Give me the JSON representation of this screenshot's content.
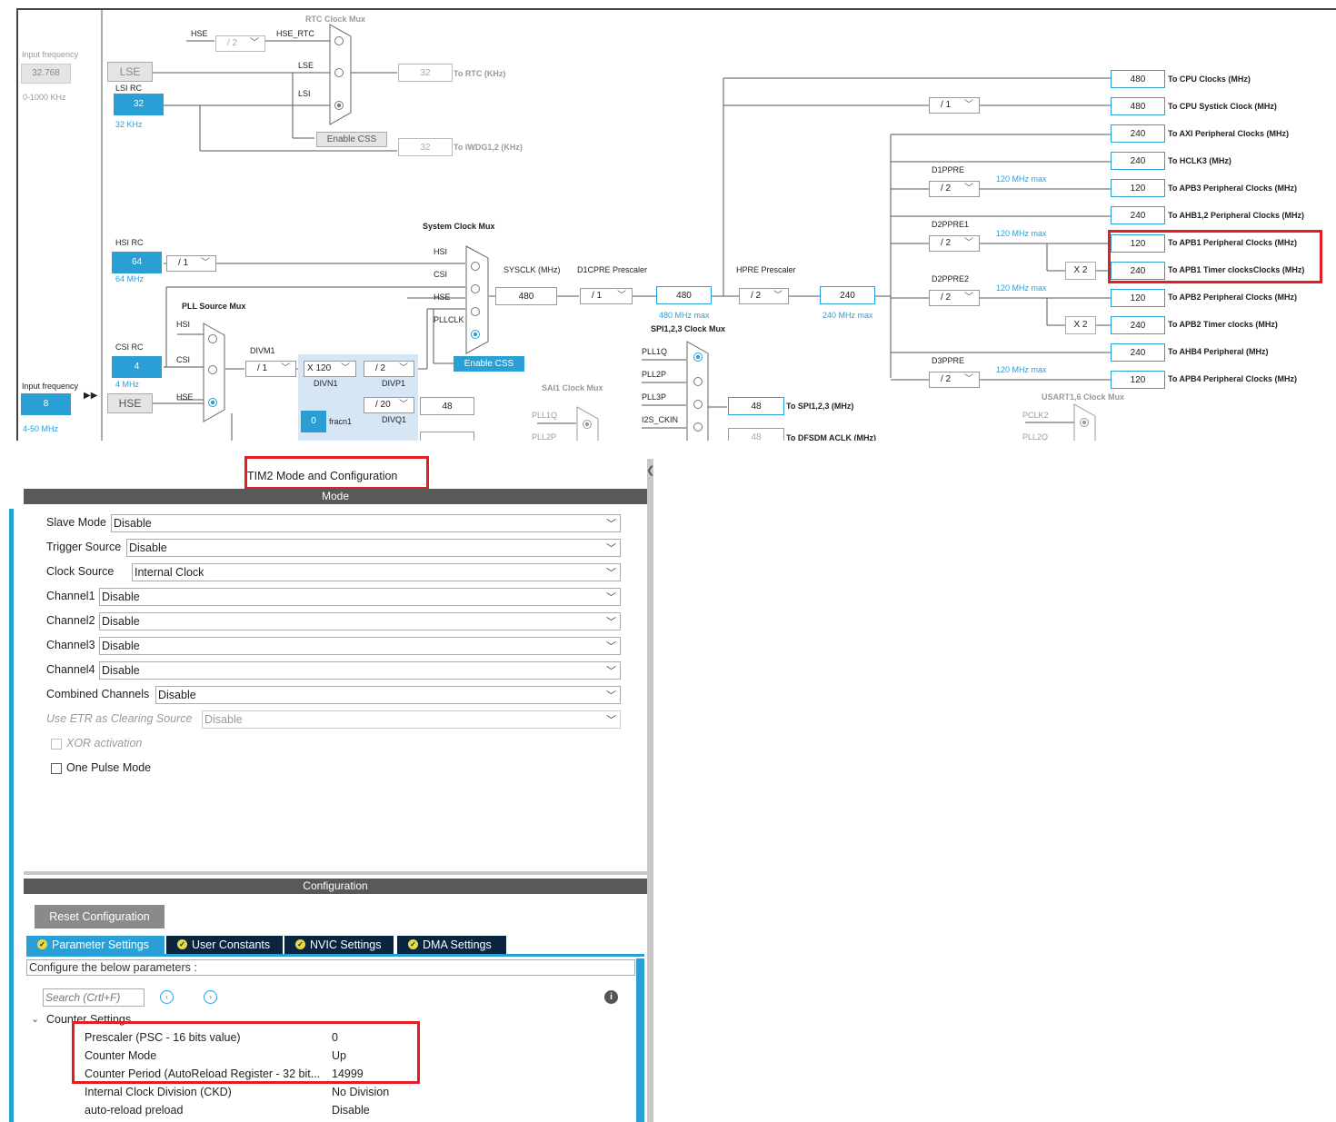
{
  "clock": {
    "rtc": {
      "title": "RTC Clock Mux",
      "hse": "HSE",
      "div": "/ 2",
      "hse_rtc": "HSE_RTC",
      "lse": "LSE",
      "lsi": "LSI",
      "enable_css": "Enable CSS",
      "rtc_val": "32",
      "rtc_lbl": "To RTC (KHz)",
      "iwdg_val": "32",
      "iwdg_lbl": "To IWDG1,2 (KHz)"
    },
    "inputs": {
      "lse_freq_lbl": "Input frequency",
      "lse_freq": "32.768",
      "lse_range": "0-1000 KHz",
      "lse": "LSE",
      "lsi_rc": "LSI RC",
      "lsi_val": "32",
      "lsi_unit": "32 KHz",
      "hsi_rc": "HSI RC",
      "hsi_val": "64",
      "hsi_div": "/ 1",
      "hsi_unit": "64 MHz",
      "csi_rc": "CSI RC",
      "csi_val": "4",
      "csi_unit": "4 MHz",
      "hse_freq_lbl": "Input frequency",
      "hse_freq": "8",
      "hse_range": "4-50 MHz",
      "hse": "HSE"
    },
    "pll": {
      "title": "PLL Source Mux",
      "hsi": "HSI",
      "csi": "CSI",
      "hse": "HSE",
      "divm1": "DIVM1",
      "divm_val": "/ 1",
      "divn_val": "X 120",
      "divn": "DIVN1",
      "divp_val": "/ 2",
      "divp": "DIVP1",
      "divq_val": "/ 20",
      "divq": "DIVQ1",
      "frac_val": "0",
      "frac": "fracn1",
      "q_out": "48"
    },
    "sys": {
      "title": "System Clock Mux",
      "hsi": "HSI",
      "csi": "CSI",
      "hse": "HSE",
      "pllclk": "PLLCLK",
      "enable_css": "Enable CSS",
      "sysclk_lbl": "SYSCLK (MHz)",
      "sysclk": "480",
      "d1cpre_lbl": "D1CPRE Prescaler",
      "d1cpre": "/ 1",
      "d1_out": "480",
      "d1_max": "480 MHz max",
      "hpre_lbl": "HPRE Prescaler",
      "hpre": "/ 2",
      "hpre_out": "240",
      "hpre_max": "240 MHz max",
      "cpu_div": "/ 1"
    },
    "spi": {
      "title": "SPI1,2,3 Clock Mux",
      "pll1q": "PLL1Q",
      "pll2p": "PLL2P",
      "pll3p": "PLL3P",
      "i2s": "I2S_CKIN",
      "val": "48",
      "lbl": "To SPI1,2,3 (MHz)",
      "dfsdm_val": "48",
      "dfsdm_lbl": "To DFSDM ACLK (MHz)"
    },
    "sai": {
      "title": "SAI1 Clock Mux",
      "pll1q": "PLL1Q",
      "pll2p": "PLL2P"
    },
    "usart": {
      "title": "USART1,6 Clock Mux",
      "pclk2": "PCLK2",
      "pll2q": "PLL2Q"
    },
    "pre": {
      "d1ppre": "D1PPRE",
      "d1ppre_val": "/ 2",
      "d2ppre1": "D2PPRE1",
      "d2ppre1_val": "/ 2",
      "d2ppre2": "D2PPRE2",
      "d2ppre2_val": "/ 2",
      "d3ppre": "D3PPRE",
      "d3ppre_val": "/ 2",
      "max": "120 MHz max",
      "x2": "X 2"
    },
    "outputs": [
      {
        "val": "480",
        "lbl": "To CPU Clocks (MHz)"
      },
      {
        "val": "480",
        "lbl": "To CPU Systick Clock (MHz)"
      },
      {
        "val": "240",
        "lbl": "To AXI Peripheral Clocks (MHz)"
      },
      {
        "val": "240",
        "lbl": "To HCLK3 (MHz)"
      },
      {
        "val": "120",
        "lbl": "To APB3 Peripheral Clocks (MHz)"
      },
      {
        "val": "240",
        "lbl": "To AHB1,2 Peripheral Clocks (MHz)"
      },
      {
        "val": "120",
        "lbl": "To APB1 Peripheral Clocks (MHz)"
      },
      {
        "val": "240",
        "lbl": "To APB1 Timer clocksClocks (MHz)"
      },
      {
        "val": "120",
        "lbl": "To APB2 Peripheral Clocks (MHz)"
      },
      {
        "val": "240",
        "lbl": "To APB2 Timer clocks (MHz)"
      },
      {
        "val": "240",
        "lbl": "To AHB4 Peripheral (MHz)"
      },
      {
        "val": "120",
        "lbl": "To APB4 Peripheral Clocks (MHz)"
      }
    ]
  },
  "tim": {
    "title": "TIM2 Mode and Configuration",
    "mode_header": "Mode",
    "mode": [
      {
        "label": "Slave Mode",
        "value": "Disable"
      },
      {
        "label": "Trigger Source",
        "value": "Disable"
      },
      {
        "label": "Clock Source",
        "value": "Internal Clock"
      },
      {
        "label": "Channel1",
        "value": "Disable"
      },
      {
        "label": "Channel2",
        "value": "Disable"
      },
      {
        "label": "Channel3",
        "value": "Disable"
      },
      {
        "label": "Channel4",
        "value": "Disable"
      },
      {
        "label": "Combined Channels",
        "value": "Disable"
      },
      {
        "label": "Use ETR as Clearing Source",
        "value": "Disable"
      }
    ],
    "xor": "XOR activation",
    "one_pulse": "One Pulse Mode",
    "config_header": "Configuration",
    "reset": "Reset Configuration",
    "tabs": [
      "Parameter Settings",
      "User Constants",
      "NVIC Settings",
      "DMA Settings"
    ],
    "configure_lbl": "Configure the below parameters :",
    "search_placeholder": "Search (Crtl+F)",
    "group": "Counter Settings",
    "params": [
      {
        "name": "Prescaler (PSC - 16 bits value)",
        "value": "0"
      },
      {
        "name": "Counter Mode",
        "value": "Up"
      },
      {
        "name": "Counter Period (AutoReload Register - 32 bit...",
        "value": "14999"
      },
      {
        "name": "Internal Clock Division (CKD)",
        "value": "No Division"
      },
      {
        "name": "auto-reload preload",
        "value": "Disable"
      }
    ]
  }
}
